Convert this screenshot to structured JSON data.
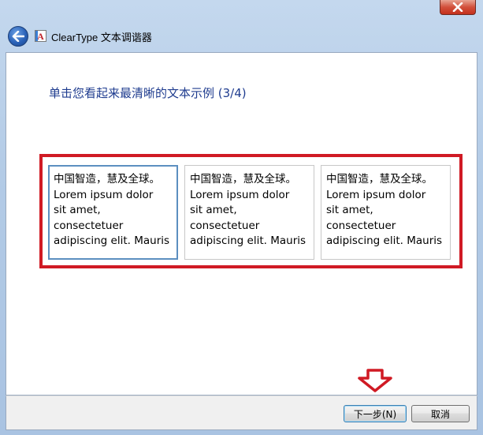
{
  "window": {
    "title": "ClearType 文本调谐器",
    "app_icon_letter": "A"
  },
  "instruction": "单击您看起来最清晰的文本示例 (3/4)",
  "samples": [
    {
      "lines": [
        "中国智造，慧及全球。",
        "Lorem ipsum dolor",
        "sit amet,",
        "consectetuer",
        "adipiscing elit. Mauris"
      ],
      "selected": true
    },
    {
      "lines": [
        "中国智造，慧及全球。",
        "Lorem ipsum dolor",
        "sit amet,",
        "consectetuer",
        "adipiscing elit. Mauris"
      ],
      "selected": false
    },
    {
      "lines": [
        "中国智造，慧及全球。",
        "Lorem ipsum dolor",
        "sit amet,",
        "consectetuer",
        "adipiscing elit. Mauris"
      ],
      "selected": false
    }
  ],
  "footer": {
    "next_label": "下一步(N)",
    "cancel_label": "取消"
  },
  "annotations": {
    "highlight_color": "#d01a24"
  },
  "icons": {
    "close": "close-icon",
    "back": "back-arrow-icon",
    "app": "cleartype-app-icon",
    "annotation_arrow": "down-arrow-icon"
  }
}
